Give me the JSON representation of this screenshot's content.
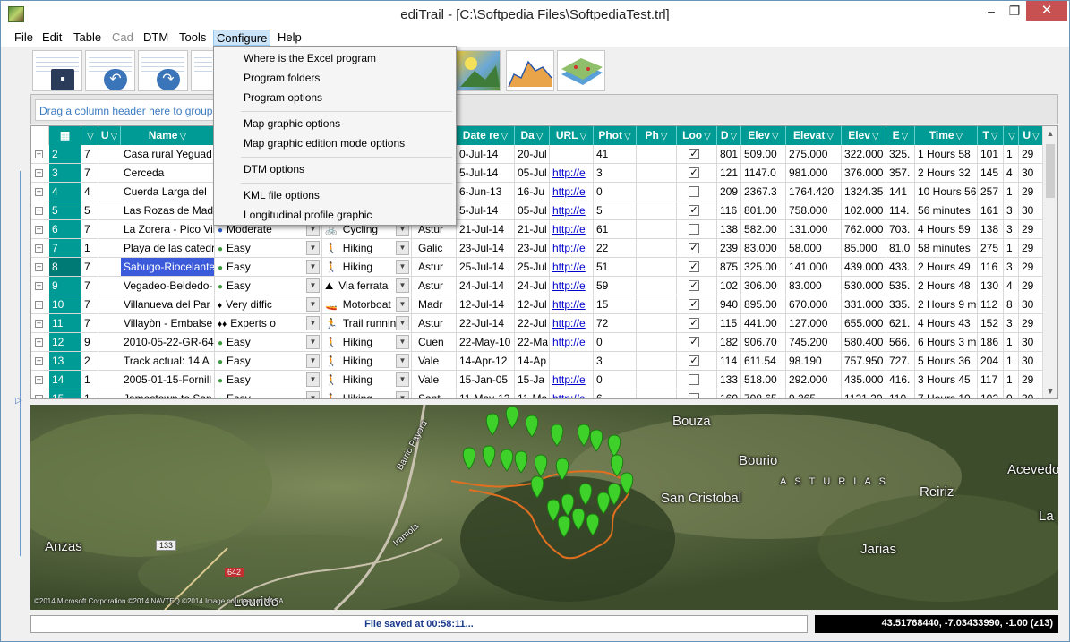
{
  "window": {
    "title": "ediTrail - [C:\\Softpedia Files\\SoftpediaTest.trl]",
    "minimize": "‒",
    "maximize": "❐",
    "close": "✕"
  },
  "menubar": [
    "File",
    "Edit",
    "Table",
    "Cad",
    "DTM",
    "Tools",
    "Configure",
    "Help"
  ],
  "configure_menu": {
    "items": [
      "Where is the Excel program",
      "Program folders",
      "Program options",
      "Map graphic options",
      "Map graphic edition mode options",
      "DTM options",
      "KML file options",
      "Longitudinal profile graphic"
    ]
  },
  "group_area": {
    "hint": "Drag a column header here to group"
  },
  "grid": {
    "headers": [
      "",
      "",
      "U",
      "Name",
      "Date re",
      "Da",
      "URL",
      "Phot",
      "Ph",
      "Loo",
      "D",
      "Elev",
      "Elevat",
      "Elev",
      "E",
      "Time",
      "T",
      "",
      "U"
    ],
    "rows": [
      {
        "id": "2",
        "u": "7",
        "name": "Casa rural Yeguad",
        "diff": "",
        "act": "",
        "region": "",
        "date": "0-Jul-14",
        "da": "20-Jul",
        "url": "",
        "photos": "41",
        "ph": "",
        "loop": true,
        "d": "801",
        "elev": "509.00",
        "elevat": "275.000",
        "elev2": "322.000",
        "e": "325.",
        "time": "1 Hours 58",
        "t": "101",
        "x": "1",
        "u2": "29"
      },
      {
        "id": "3",
        "u": "7",
        "name": "Cerceda",
        "diff": "",
        "act": "",
        "region": "",
        "date": "5-Jul-14",
        "da": "05-Jul",
        "url": "http://e",
        "photos": "3",
        "ph": "",
        "loop": true,
        "d": "121",
        "elev": "1147.0",
        "elevat": "981.000",
        "elev2": "376.000",
        "e": "357.",
        "time": "2 Hours 32",
        "t": "145",
        "x": "4",
        "u2": "30"
      },
      {
        "id": "4",
        "u": "4",
        "name": "Cuerda Larga del",
        "diff": "",
        "act": "",
        "region": "",
        "date": "6-Jun-13",
        "da": "16-Ju",
        "url": "http://e",
        "photos": "0",
        "ph": "",
        "loop": false,
        "d": "209",
        "elev": "2367.3",
        "elevat": "1764.420",
        "elev2": "1324.35",
        "e": "141",
        "time": "10 Hours 56",
        "t": "257",
        "x": "1",
        "u2": "29"
      },
      {
        "id": "5",
        "u": "5",
        "name": "Las Rozas de Mad",
        "diff": "",
        "act": "",
        "region": "",
        "date": "5-Jul-14",
        "da": "05-Jul",
        "url": "http://e",
        "photos": "5",
        "ph": "",
        "loop": true,
        "d": "116",
        "elev": "801.00",
        "elevat": "758.000",
        "elev2": "102.000",
        "e": "114.",
        "time": "56 minutes",
        "t": "161",
        "x": "3",
        "u2": "30"
      },
      {
        "id": "6",
        "u": "7",
        "name": "La Zorera - Pico Vil",
        "diff": "Moderate",
        "act": "Cycling",
        "region": "Astur",
        "date": "21-Jul-14",
        "da": "21-Jul",
        "url": "http://e",
        "photos": "61",
        "ph": "",
        "loop": false,
        "d": "138",
        "elev": "582.00",
        "elevat": "131.000",
        "elev2": "762.000",
        "e": "703.",
        "time": "4 Hours 59",
        "t": "138",
        "x": "3",
        "u2": "29"
      },
      {
        "id": "7",
        "u": "1",
        "name": "Playa de las catedr",
        "diff": "Easy",
        "act": "Hiking",
        "region": "Galic",
        "date": "23-Jul-14",
        "da": "23-Jul",
        "url": "http://e",
        "photos": "22",
        "ph": "",
        "loop": true,
        "d": "239",
        "elev": "83.000",
        "elevat": "58.000",
        "elev2": "85.000",
        "e": "81.0",
        "time": "58 minutes",
        "t": "275",
        "x": "1",
        "u2": "29"
      },
      {
        "id": "8",
        "u": "7",
        "name": "Sabugo-Riocelante",
        "diff": "Easy",
        "act": "Hiking",
        "region": "Astur",
        "date": "25-Jul-14",
        "da": "25-Jul",
        "url": "http://e",
        "photos": "51",
        "ph": "",
        "loop": true,
        "d": "875",
        "elev": "325.00",
        "elevat": "141.000",
        "elev2": "439.000",
        "e": "433.",
        "time": "2 Hours 49",
        "t": "116",
        "x": "3",
        "u2": "29"
      },
      {
        "id": "9",
        "u": "7",
        "name": "Vegadeo-Beldedo-",
        "diff": "Easy",
        "act": "Via ferrata",
        "region": "Astur",
        "date": "24-Jul-14",
        "da": "24-Jul",
        "url": "http://e",
        "photos": "59",
        "ph": "",
        "loop": true,
        "d": "102",
        "elev": "306.00",
        "elevat": "83.000",
        "elev2": "530.000",
        "e": "535.",
        "time": "2 Hours 48",
        "t": "130",
        "x": "4",
        "u2": "29"
      },
      {
        "id": "10",
        "u": "7",
        "name": "Villanueva del Par",
        "diff": "Very diffic",
        "act": "Motorboat",
        "region": "Madr",
        "date": "12-Jul-14",
        "da": "12-Jul",
        "url": "http://e",
        "photos": "15",
        "ph": "",
        "loop": true,
        "d": "940",
        "elev": "895.00",
        "elevat": "670.000",
        "elev2": "331.000",
        "e": "335.",
        "time": "2 Hours 9 m",
        "t": "112",
        "x": "8",
        "u2": "30"
      },
      {
        "id": "11",
        "u": "7",
        "name": "Villayòn - Embalse",
        "diff": "Experts o",
        "act": "Trail running",
        "region": "Astur",
        "date": "22-Jul-14",
        "da": "22-Jul",
        "url": "http://e",
        "photos": "72",
        "ph": "",
        "loop": true,
        "d": "115",
        "elev": "441.00",
        "elevat": "127.000",
        "elev2": "655.000",
        "e": "621.",
        "time": "4 Hours 43",
        "t": "152",
        "x": "3",
        "u2": "29"
      },
      {
        "id": "12",
        "u": "9",
        "name": "2010-05-22-GR-64",
        "diff": "Easy",
        "act": "Hiking",
        "region": "Cuen",
        "date": "22-May-10",
        "da": "22-Ma",
        "url": "http://e",
        "photos": "0",
        "ph": "",
        "loop": true,
        "d": "182",
        "elev": "906.70",
        "elevat": "745.200",
        "elev2": "580.400",
        "e": "566.",
        "time": "6 Hours 3 m",
        "t": "186",
        "x": "1",
        "u2": "30"
      },
      {
        "id": "13",
        "u": "2",
        "name": "Track actual: 14 A",
        "diff": "Easy",
        "act": "Hiking",
        "region": "Vale",
        "date": "14-Apr-12",
        "da": "14-Ap",
        "url": "",
        "photos": "3",
        "ph": "",
        "loop": true,
        "d": "114",
        "elev": "611.54",
        "elevat": "98.190",
        "elev2": "757.950",
        "e": "727.",
        "time": "5 Hours 36",
        "t": "204",
        "x": "1",
        "u2": "30"
      },
      {
        "id": "14",
        "u": "1",
        "name": "2005-01-15-Fornill",
        "diff": "Easy",
        "act": "Hiking",
        "region": "Vale",
        "date": "15-Jan-05",
        "da": "15-Ja",
        "url": "http://e",
        "photos": "0",
        "ph": "",
        "loop": false,
        "d": "133",
        "elev": "518.00",
        "elevat": "292.000",
        "elev2": "435.000",
        "e": "416.",
        "time": "3 Hours 45",
        "t": "117",
        "x": "1",
        "u2": "29"
      },
      {
        "id": "15",
        "u": "1",
        "name": "Jamestown to San",
        "diff": "Easy",
        "act": "Hiking",
        "region": "Sant",
        "date": "11-May-12",
        "da": "11-Ma",
        "url": "http://e",
        "photos": "6",
        "ph": "",
        "loop": false,
        "d": "160",
        "elev": "708.65",
        "elevat": "9.265",
        "elev2": "1121.20",
        "e": "110",
        "time": "7 Hours 10",
        "t": "102",
        "x": "0",
        "u2": "30"
      }
    ]
  },
  "map": {
    "labels": [
      "Bouza",
      "Bourio",
      "San Cristobal",
      "ASTURIAS",
      "Reiriz",
      "Acevedo",
      "La",
      "Jarias",
      "Anzas",
      "Barrio Payora",
      "Iramola",
      "133",
      "642",
      "Lourido"
    ],
    "copyright": "©2014 Microsoft Corporation ©2014 NAVTEQ ©2014 Image courtesy of NASA"
  },
  "status": {
    "message": "File saved at 00:58:11...",
    "coords": "43.51768440, -7.03433990, -1.00 (z13)"
  },
  "colors": {
    "header_teal": "#009b94",
    "selection": "#3b5bdb",
    "link": "#0000cc"
  }
}
